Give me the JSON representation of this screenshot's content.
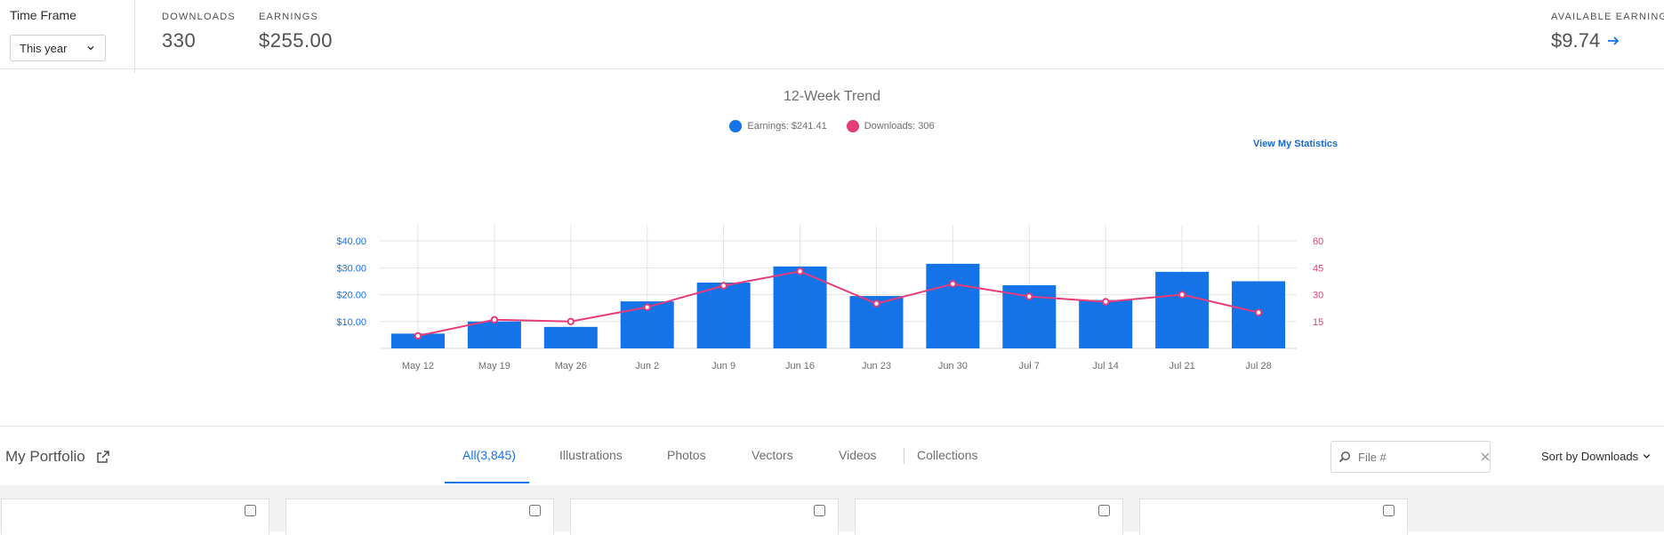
{
  "topbar": {
    "time_frame_label": "Time Frame",
    "time_frame_value": "This year",
    "downloads_label": "DOWNLOADS",
    "downloads_value": "330",
    "earnings_label": "EARNINGS",
    "earnings_value": "$255.00",
    "available_label": "AVAILABLE EARNINGS",
    "available_value": "$9.74"
  },
  "chart_data": {
    "type": "bar",
    "title": "12-Week Trend",
    "categories": [
      "May 12",
      "May 19",
      "May 26",
      "Jun 2",
      "Jun 9",
      "Jun 16",
      "Jun 23",
      "Jun 30",
      "Jul 7",
      "Jul 14",
      "Jul 21",
      "Jul 28"
    ],
    "series": [
      {
        "name": "Earnings: $241.41",
        "type": "bar",
        "axis": "left",
        "color": "#1473e6",
        "values": [
          5.5,
          10,
          8,
          17.5,
          24.5,
          30.5,
          19.5,
          31.5,
          23.5,
          18,
          28.5,
          25
        ]
      },
      {
        "name": "Downloads: 306",
        "type": "line",
        "axis": "right",
        "color": "#e63c7a",
        "values": [
          7,
          16,
          15,
          23,
          35,
          43,
          25,
          36,
          29,
          26,
          30,
          20
        ]
      }
    ],
    "y_left": {
      "ticks": [
        "$10.00",
        "$20.00",
        "$30.00",
        "$40.00"
      ],
      "tick_values": [
        10,
        20,
        30,
        40
      ],
      "range": [
        0,
        46
      ]
    },
    "y_right": {
      "ticks": [
        "15",
        "30",
        "45",
        "60"
      ],
      "tick_values": [
        15,
        30,
        45,
        60
      ],
      "range": [
        0,
        69
      ]
    },
    "grid": true,
    "legend": "top-center"
  },
  "view_stats_label": "View My Statistics",
  "portfolio": {
    "title": "My Portfolio",
    "tabs": [
      {
        "label": "All(3,845)",
        "active": true
      },
      {
        "label": "Illustrations",
        "active": false
      },
      {
        "label": "Photos",
        "active": false
      },
      {
        "label": "Vectors",
        "active": false
      },
      {
        "label": "Videos",
        "active": false
      },
      {
        "label": "Collections",
        "active": false
      }
    ],
    "search_placeholder": "File #",
    "sort_label": "Sort by Downloads"
  },
  "colors": {
    "accent": "#1473e6",
    "downloads": "#e63c7a"
  }
}
